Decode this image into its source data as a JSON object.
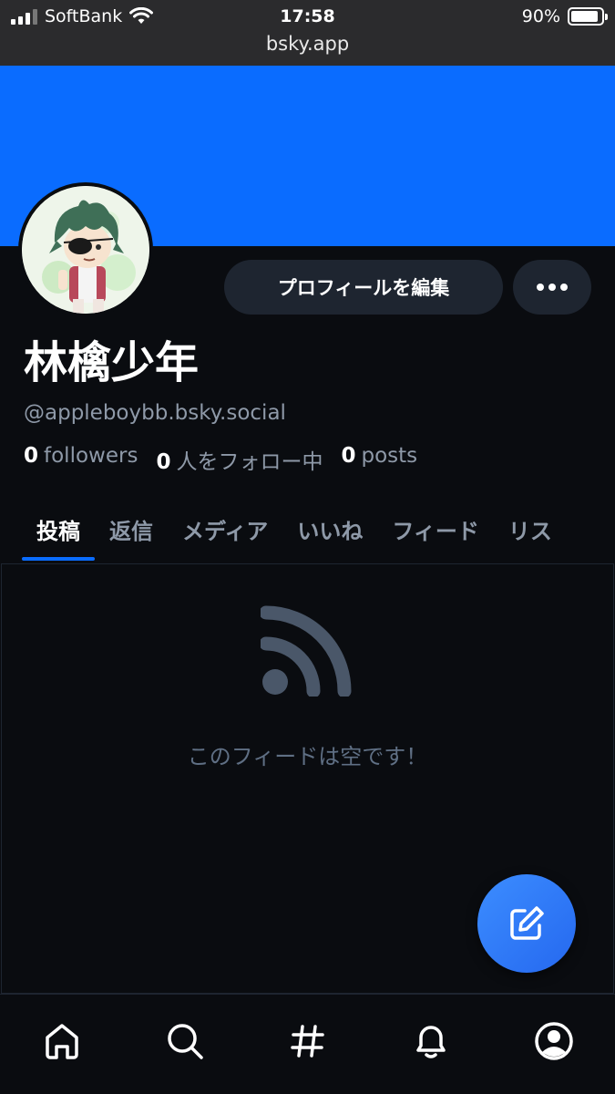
{
  "status_bar": {
    "carrier": "SoftBank",
    "time": "17:58",
    "battery": "90%",
    "battery_level": 0.9
  },
  "browser": {
    "url": "bsky.app"
  },
  "profile": {
    "display_name": "林檎少年",
    "handle": "@appleboybb.bsky.social",
    "banner_color": "#0a6cff",
    "edit_button_label": "プロフィールを編集",
    "more_icon": "ellipsis-icon",
    "stats": {
      "followers_count": "0",
      "followers_label": "followers",
      "following_count": "0",
      "following_label": "人をフォロー中",
      "posts_count": "0",
      "posts_label": "posts"
    }
  },
  "tabs": [
    {
      "label": "投稿",
      "active": true
    },
    {
      "label": "返信",
      "active": false
    },
    {
      "label": "メディア",
      "active": false
    },
    {
      "label": "いいね",
      "active": false
    },
    {
      "label": "フィード",
      "active": false
    },
    {
      "label": "リス",
      "active": false
    }
  ],
  "feed": {
    "empty_icon": "rss-feed-icon",
    "empty_message": "このフィードは空です！"
  },
  "fab": {
    "icon": "compose-icon",
    "color": "#2f7bf7"
  },
  "bottom_nav": [
    {
      "name": "home",
      "icon": "home-icon"
    },
    {
      "name": "search",
      "icon": "search-icon"
    },
    {
      "name": "feeds",
      "icon": "hashtag-icon"
    },
    {
      "name": "notifications",
      "icon": "bell-icon"
    },
    {
      "name": "profile",
      "icon": "user-icon"
    }
  ]
}
